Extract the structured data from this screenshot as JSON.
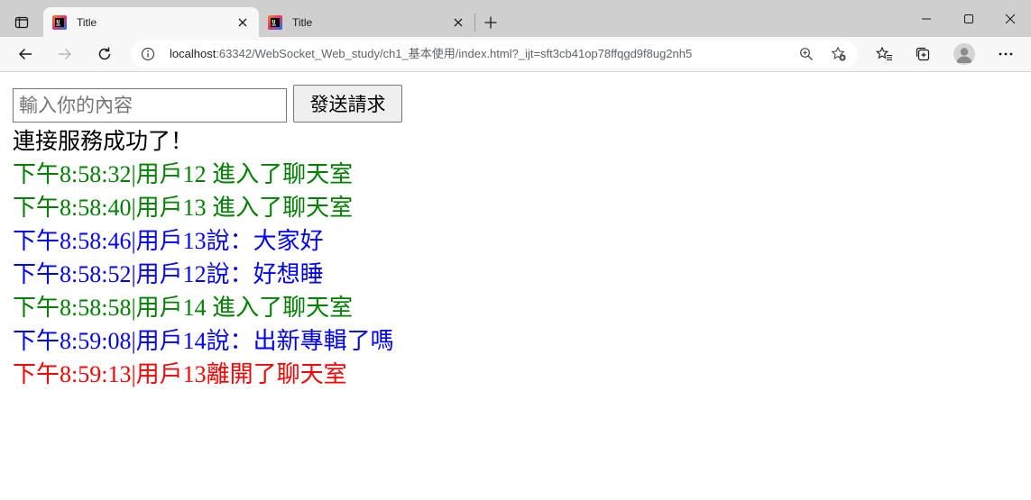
{
  "tabs": [
    {
      "title": "Title",
      "active": true
    },
    {
      "title": "Title",
      "active": false
    }
  ],
  "address": {
    "host": "localhost",
    "path": ":63342/WebSocket_Web_study/ch1_基本使用/index.html?_ijt=sft3cb41op78ffqgd9f8ug2nh5"
  },
  "form": {
    "placeholder": "輸入你的內容",
    "value": "",
    "send_label": "發送請求"
  },
  "connection_status": "連接服務成功了！",
  "colors": {
    "join": "#008000",
    "say": "#0000ff",
    "leave": "#ff0000"
  },
  "messages": [
    {
      "kind": "join",
      "text": "下午8:58:32|用戶12 進入了聊天室"
    },
    {
      "kind": "join",
      "text": "下午8:58:40|用戶13 進入了聊天室"
    },
    {
      "kind": "say",
      "text": "下午8:58:46|用戶13說：大家好"
    },
    {
      "kind": "say",
      "text": "下午8:58:52|用戶12說：好想睡"
    },
    {
      "kind": "join",
      "text": "下午8:58:58|用戶14 進入了聊天室"
    },
    {
      "kind": "say",
      "text": "下午8:59:08|用戶14說：出新專輯了嗎"
    },
    {
      "kind": "leave",
      "text": "下午8:59:13|用戶13離開了聊天室"
    }
  ],
  "icons": {
    "tab_actions": "tab-actions-icon",
    "favicon": "jetbrains-icon",
    "close": "close-icon",
    "new_tab": "plus-icon",
    "back": "back-arrow-icon",
    "forward": "forward-arrow-icon",
    "refresh": "refresh-icon",
    "info": "info-icon",
    "zoom": "zoom-icon",
    "favorite_add": "star-add-icon",
    "favorites": "favorites-icon",
    "collections": "collections-icon",
    "profile": "avatar",
    "more": "more-icon"
  }
}
